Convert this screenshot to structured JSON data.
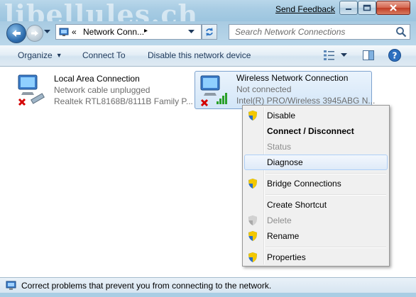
{
  "titlebar": {
    "watermark": "libellules.ch",
    "send_feedback": "Send Feedback"
  },
  "address": {
    "prefix": "«",
    "crumb": "Network Conn...",
    "crumb_arrow": "▸",
    "search_placeholder": "Search Network Connections"
  },
  "commands": {
    "organize": "Organize",
    "connect_to": "Connect To",
    "disable_device": "Disable this network device"
  },
  "connections": [
    {
      "name": "Local Area Connection",
      "status": "Network cable unplugged",
      "device": "Realtek RTL8168B/8111B Family P..."
    },
    {
      "name": "Wireless Network Connection",
      "status": "Not connected",
      "device": "Intel(R) PRO/Wireless 3945ABG N..."
    }
  ],
  "context_menu": {
    "items": [
      {
        "label": "Disable",
        "icon": "shield-icon"
      },
      {
        "label": "Connect / Disconnect"
      },
      {
        "label": "Status"
      },
      {
        "label": "Diagnose"
      },
      {
        "label": "Bridge Connections",
        "icon": "shield-icon"
      },
      {
        "label": "Create Shortcut"
      },
      {
        "label": "Delete",
        "icon": "shield-icon"
      },
      {
        "label": "Rename",
        "icon": "shield-icon"
      },
      {
        "label": "Properties",
        "icon": "shield-icon"
      }
    ]
  },
  "statusbar": {
    "text": "Correct problems that prevent you from connecting to the network."
  },
  "colors": {
    "accent": "#1e395b",
    "glass": "#a9cde4",
    "selection_border": "#7da2ce",
    "error_red": "#d40000"
  }
}
